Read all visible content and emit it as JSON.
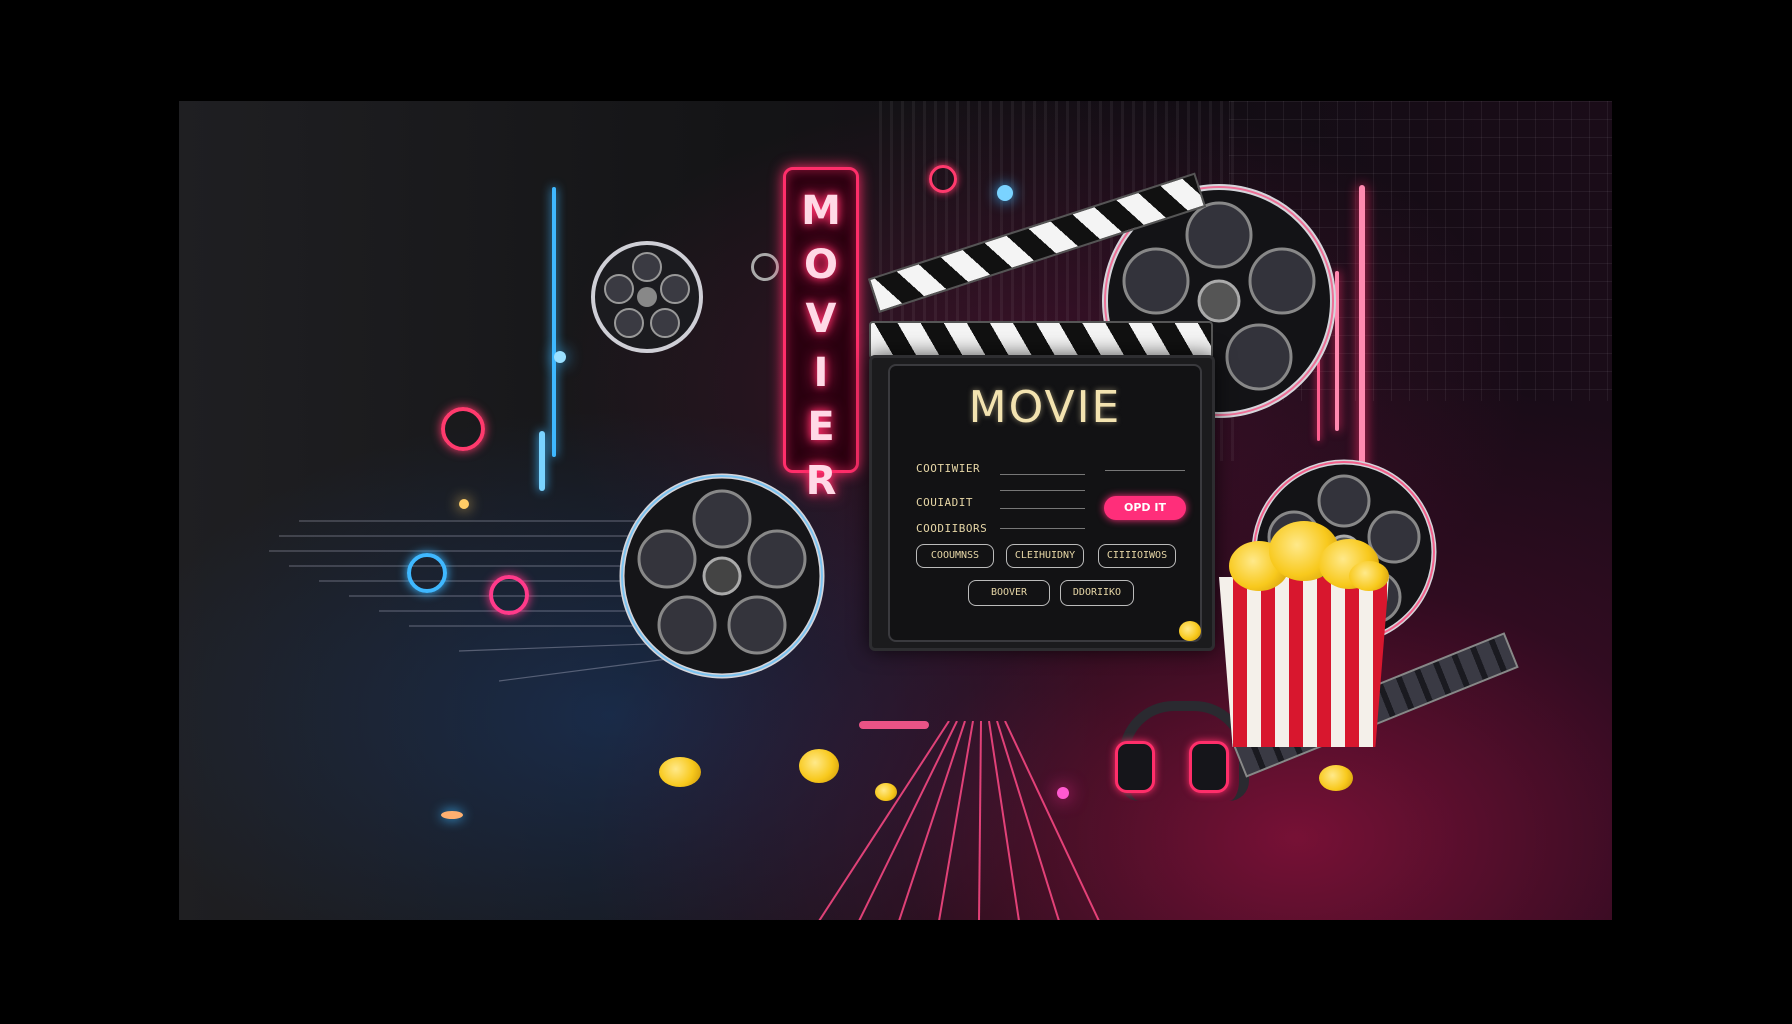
{
  "sign": {
    "text": "MOVIER",
    "color": "#ff2e6a"
  },
  "screen": {
    "title": "MOVIE",
    "fields": [
      "COOTIWIER",
      "COUIADIT",
      "COODIIBORS"
    ],
    "pink_button": "OPD IT",
    "row_buttons": [
      "COOUMNSS",
      "CLEIHUIDNY",
      "CIIIIOIWOS"
    ],
    "bottom_buttons": [
      "BOOVER",
      "DDORIIKO"
    ]
  },
  "colors": {
    "neon_pink": "#ff2e6a",
    "neon_blue": "#3fb8ff",
    "popcorn": "#f8c91d",
    "board_text": "#f3e3b0"
  },
  "icons": [
    "film-reel-icon",
    "clapperboard-icon",
    "popcorn-icon",
    "headphones-icon",
    "filmstrip-icon"
  ]
}
